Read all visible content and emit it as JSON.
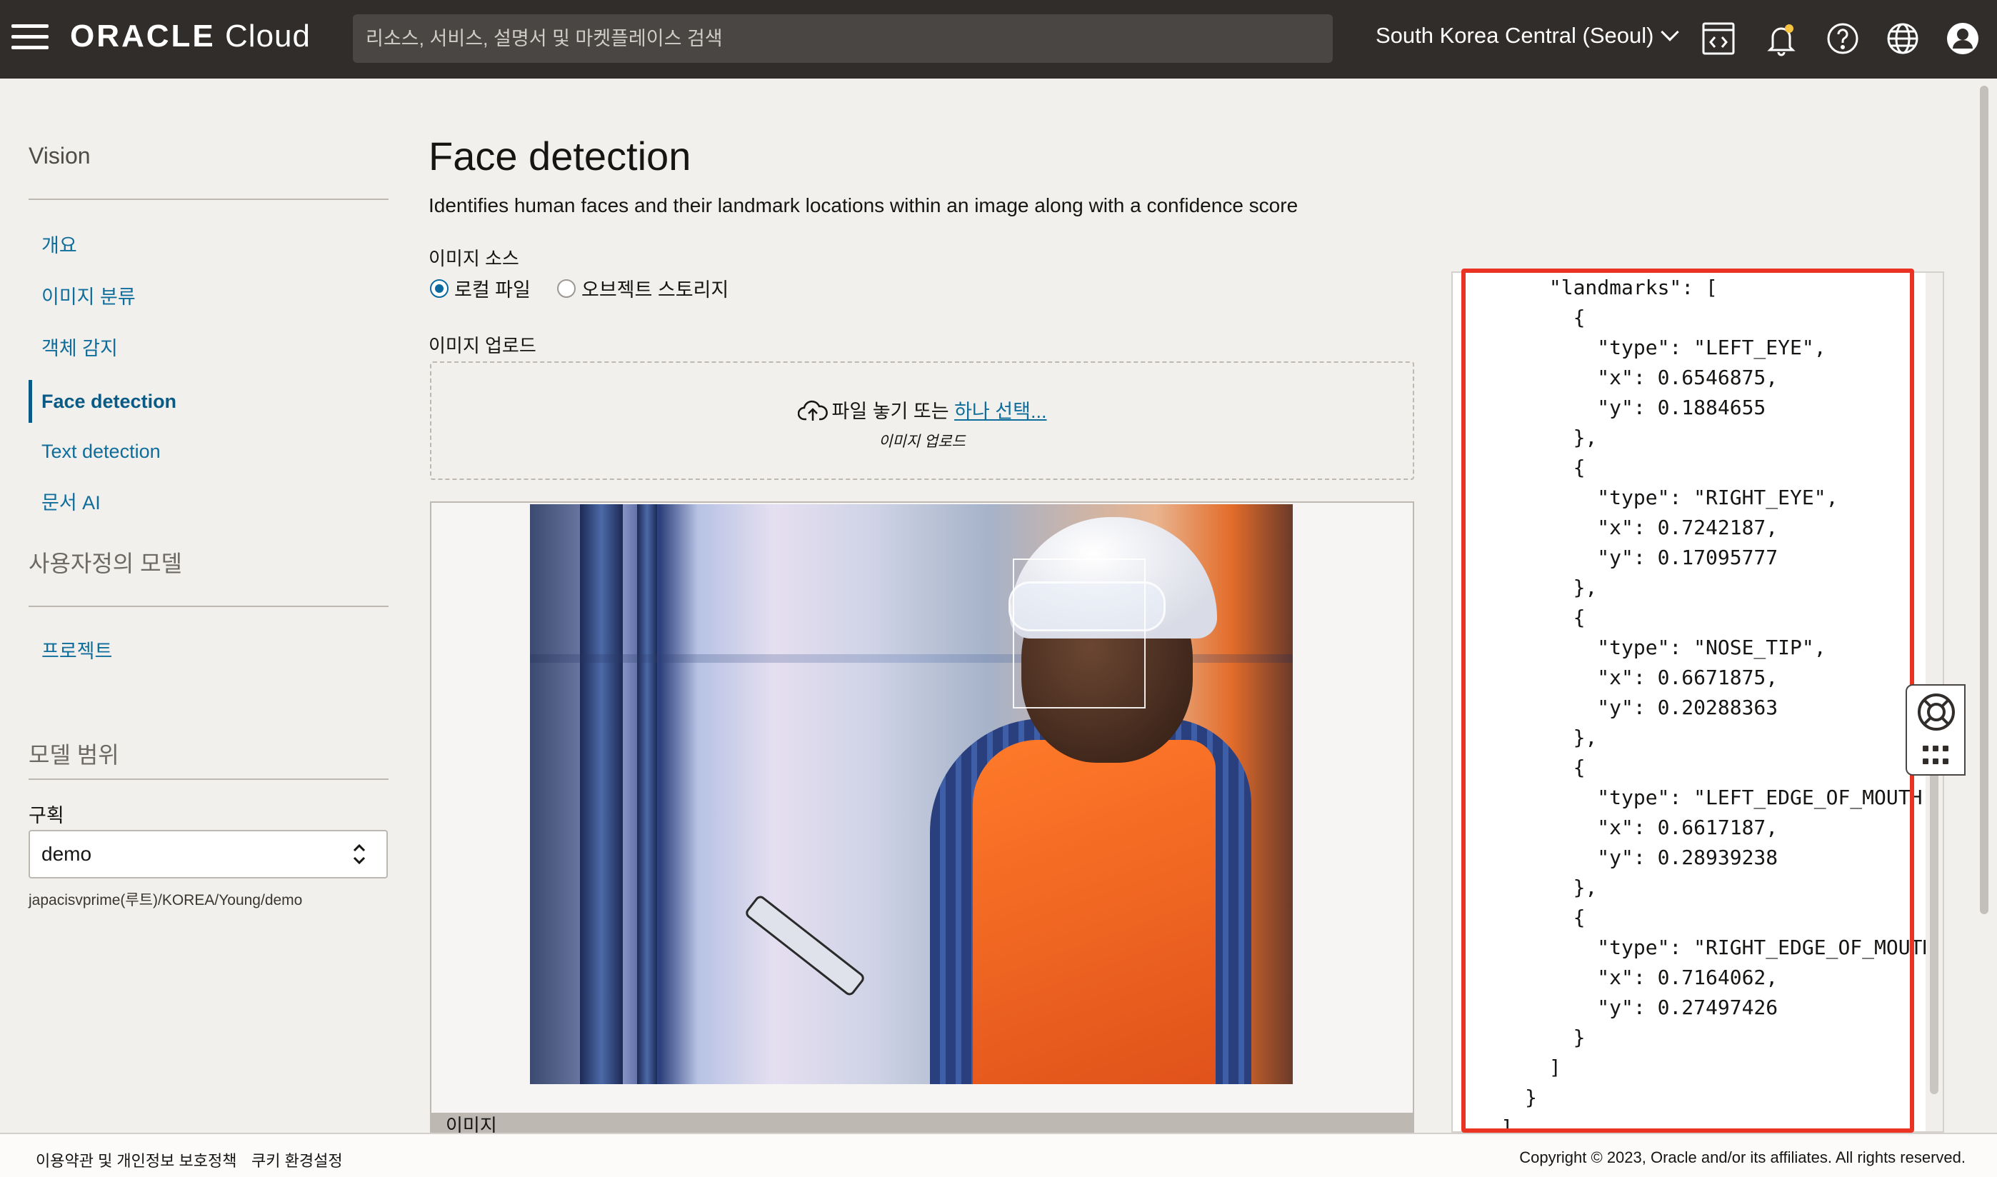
{
  "header": {
    "logo_brand": "ORACLE",
    "logo_product": "Cloud",
    "search_placeholder": "리소스, 서비스, 설명서 및 마켓플레이스 검색",
    "region": "South Korea Central (Seoul)",
    "icons": [
      "hamburger-menu-icon",
      "code-editor-icon",
      "bell-icon",
      "help-icon",
      "globe-icon",
      "user-avatar-icon"
    ]
  },
  "sidebar": {
    "title": "Vision",
    "items": [
      {
        "label": "개요",
        "active": false
      },
      {
        "label": "이미지 분류",
        "active": false
      },
      {
        "label": "객체 감지",
        "active": false
      },
      {
        "label": "Face detection",
        "active": true
      },
      {
        "label": "Text detection",
        "active": false
      },
      {
        "label": "문서 AI",
        "active": false
      }
    ],
    "custom_models_title": "사용자정의 모델",
    "custom_items": [
      {
        "label": "프로젝트"
      }
    ],
    "scope_title": "모델 범위",
    "compartment_label": "구획",
    "compartment_value": "demo",
    "compartment_path": "japacisvprime(루트)/KOREA/Young/demo"
  },
  "main": {
    "title": "Face detection",
    "description": "Identifies human faces and their landmark locations within an image along with a confidence score",
    "image_source_label": "이미지 소스",
    "source_options": [
      {
        "label": "로컬 파일",
        "selected": true
      },
      {
        "label": "오브젝트 스토리지",
        "selected": false
      }
    ],
    "upload_label": "이미지 업로드",
    "drop_text": "파일 놓기 또는",
    "drop_link": "하나 선택...",
    "drop_sub": "이미지 업로드",
    "image_caption": "이미지"
  },
  "json_output": {
    "lines": [
      "        \"landmarks\": [",
      "          {",
      "            \"type\": \"LEFT_EYE\",",
      "            \"x\": 0.6546875,",
      "            \"y\": 0.1884655",
      "          },",
      "          {",
      "            \"type\": \"RIGHT_EYE\",",
      "            \"x\": 0.7242187,",
      "            \"y\": 0.17095777",
      "          },",
      "          {",
      "            \"type\": \"NOSE_TIP\",",
      "            \"x\": 0.6671875,",
      "            \"y\": 0.20288363",
      "          },",
      "          {",
      "            \"type\": \"LEFT_EDGE_OF_MOUTH\",",
      "            \"x\": 0.6617187,",
      "            \"y\": 0.28939238",
      "          },",
      "          {",
      "            \"type\": \"RIGHT_EDGE_OF_MOUTH\",",
      "            \"x\": 0.7164062,",
      "            \"y\": 0.27497426",
      "          }",
      "        ]",
      "      }",
      "    ]"
    ],
    "highlight_color": "#ea3323"
  },
  "footer": {
    "terms": "이용약관 및 개인정보 보호정책",
    "cookies": "쿠키 환경설정",
    "copyright": "Copyright © 2023, Oracle and/or its affiliates. All rights reserved."
  },
  "colors": {
    "topbar": "#312d2a",
    "link": "#0f6d9c",
    "background": "#f1f0ec"
  }
}
